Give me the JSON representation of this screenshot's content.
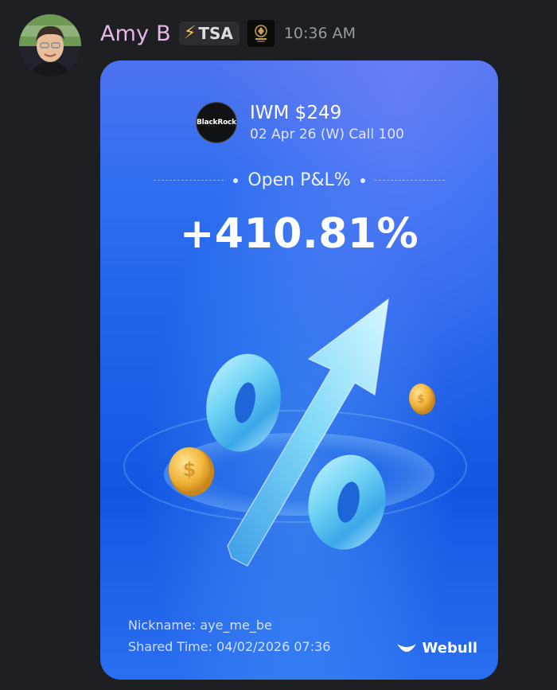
{
  "message": {
    "username": "Amy B",
    "role_tag": {
      "icon": "lightning-bolt-icon",
      "label": "TSA"
    },
    "server_badge": "server-crest-icon",
    "timestamp": "10:36 AM"
  },
  "card": {
    "brand_logo_text": "BlackRock",
    "ticker_title": "IWM $249",
    "ticker_subtitle": "02 Apr 26 (W) Call 100",
    "pl_label": "Open P&L%",
    "pl_value": "+410.81%",
    "nickname_line": "Nickname: aye_me_be",
    "shared_time_line": "Shared Time: 04/02/2026 07:36",
    "webull_label": "Webull"
  },
  "colors": {
    "background": "#1e1f22",
    "username": "#e8b7e8",
    "timestamp": "#949ba4",
    "card_blue": "#1f63ea"
  }
}
